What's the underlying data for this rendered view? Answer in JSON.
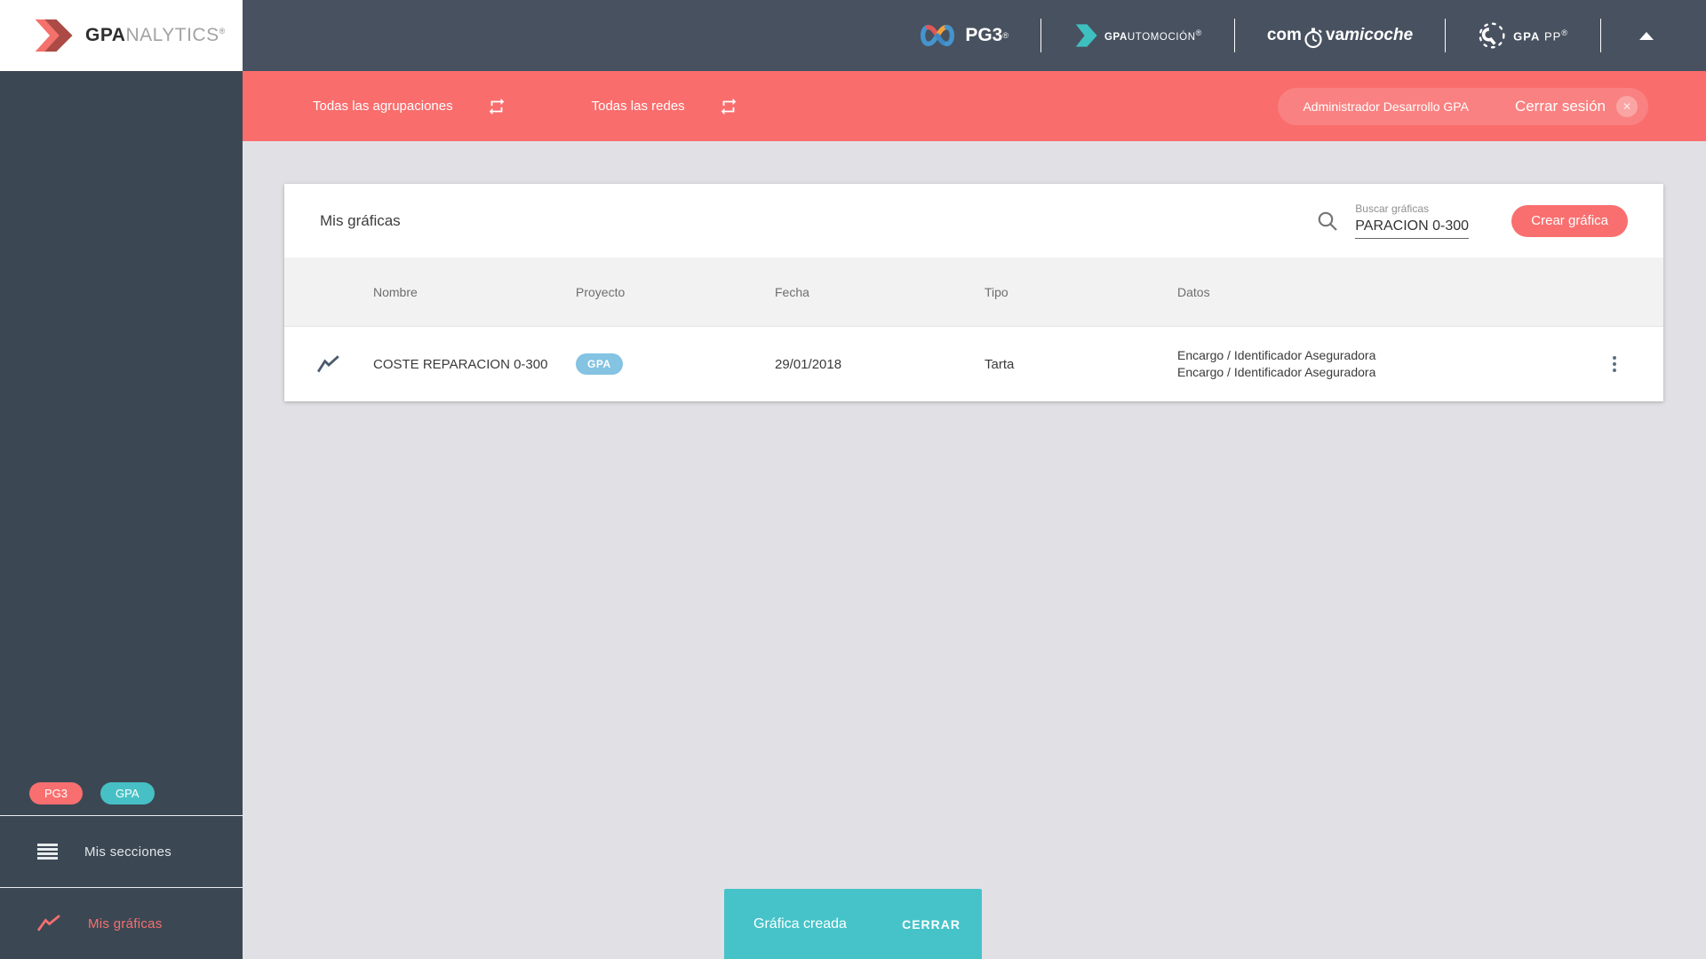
{
  "brand": {
    "logo_bold": "GPA",
    "logo_light": "NALYTICS",
    "logo_reg": "®"
  },
  "header": {
    "pg3": {
      "label": "PG3",
      "reg": "®"
    },
    "automocion": {
      "bold": "GPA",
      "rest": "UTOMOCIÓN",
      "reg": "®"
    },
    "compravamicoche": {
      "pre": "com",
      "mid": "va",
      "post": "micoche"
    },
    "gpapp": {
      "bold": "GPA",
      "rest": "PP",
      "reg": "®"
    }
  },
  "filter_bar": {
    "groupings": "Todas las agrupaciones",
    "networks": "Todas las redes",
    "user": "Administrador Desarrollo GPA",
    "logout": "Cerrar sesión"
  },
  "sidebar": {
    "badge_pg3": "PG3",
    "badge_gpa": "GPA",
    "sections_item": "Mis secciones",
    "charts_item": "Mis gráficas"
  },
  "main": {
    "title": "Mis gráficas",
    "search_label": "Buscar gráficas",
    "search_value": "PARACION 0-300",
    "create_button": "Crear gráfica",
    "table": {
      "columns": [
        "Nombre",
        "Proyecto",
        "Fecha",
        "Tipo",
        "Datos"
      ],
      "rows": [
        {
          "nombre": "COSTE REPARACION 0-300",
          "proyecto_badge": "GPA",
          "fecha": "29/01/2018",
          "tipo": "Tarta",
          "datos": [
            "Encargo / Identificador Aseguradora",
            "Encargo / Identificador Aseguradora"
          ]
        }
      ]
    }
  },
  "toast": {
    "message": "Gráfica creada",
    "action": "CERRAR"
  },
  "colors": {
    "accent_coral": "#f96f6f",
    "filter_bar_red": "#fa6d6d",
    "toast_teal": "#46c3c9",
    "badge_blue": "#84c3e1",
    "badge_teal": "#47c0c5",
    "header_bg": "#48515f",
    "sidebar_bg": "#3b4854",
    "content_bg": "#e1e1e5"
  },
  "icons": {
    "swap": "repeat-arrows",
    "search": "magnifier",
    "menu": "hamburger-lines",
    "chart": "trending-line",
    "row_menu": "kebab-dots",
    "logout_close": "x-circle",
    "collapse": "triangle-up",
    "compravamicoche": "stopwatch",
    "gpapp": "wrench-gauge"
  }
}
